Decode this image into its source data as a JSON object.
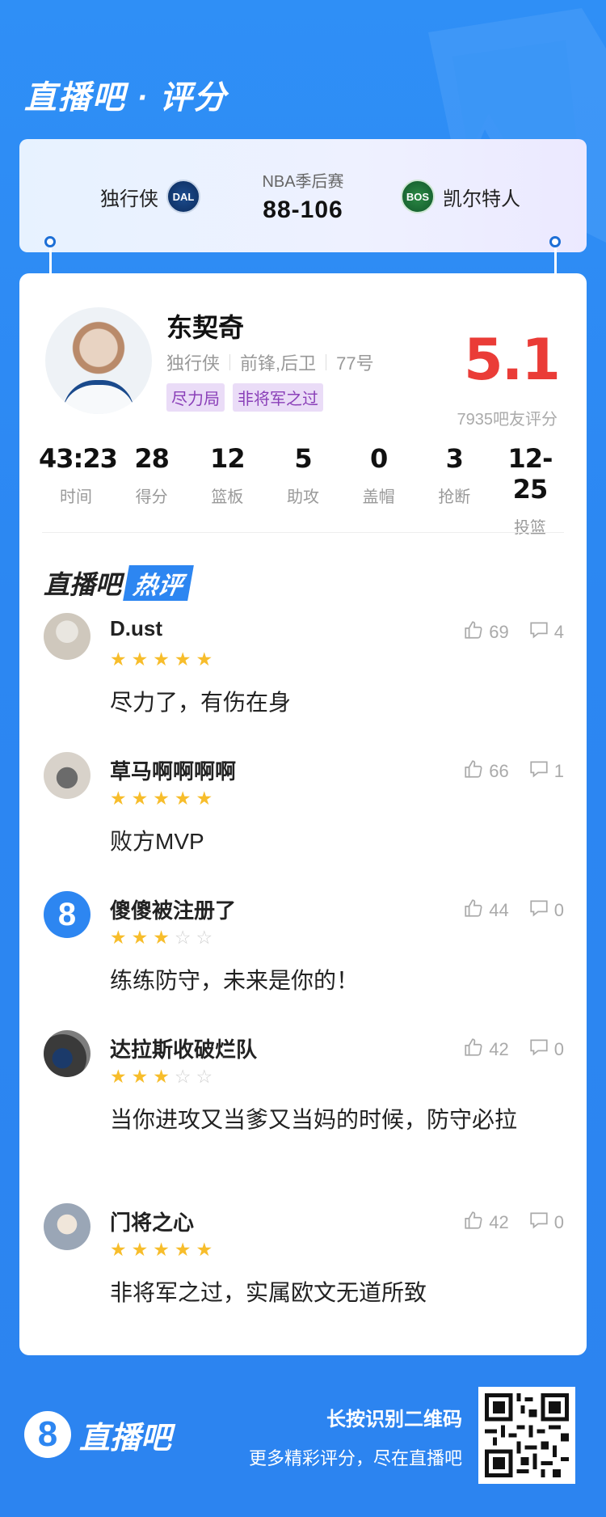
{
  "header": {
    "title": "直播吧 · 评分"
  },
  "match": {
    "home_team": "独行侠",
    "home_logo_text": "DAL",
    "away_team": "凯尔特人",
    "away_logo_text": "BOS",
    "competition": "NBA季后赛",
    "score": "88-106"
  },
  "player": {
    "name": "东契奇",
    "team": "独行侠",
    "position": "前锋,后卫",
    "number": "77号",
    "tags": [
      "尽力局",
      "非将军之过"
    ],
    "rating": "5.1",
    "rating_count": "7935吧友评分",
    "stats": [
      {
        "value": "43:23",
        "label": "时间"
      },
      {
        "value": "28",
        "label": "得分"
      },
      {
        "value": "12",
        "label": "篮板"
      },
      {
        "value": "5",
        "label": "助攻"
      },
      {
        "value": "0",
        "label": "盖帽"
      },
      {
        "value": "3",
        "label": "抢断"
      },
      {
        "value": "12-25",
        "label": "投篮"
      }
    ]
  },
  "hot_comments": {
    "title_left": "直播吧",
    "title_right": "热评",
    "items": [
      {
        "user": "D.ust",
        "stars": 5,
        "likes": "69",
        "replies": "4",
        "text": "尽力了，有伤在身",
        "avatar_icon": "user-photo-avatar"
      },
      {
        "user": "草马啊啊啊啊",
        "stars": 5,
        "likes": "66",
        "replies": "1",
        "text": "败方MVP",
        "avatar_icon": "cat-photo-avatar"
      },
      {
        "user": "傻傻被注册了",
        "stars": 3,
        "likes": "44",
        "replies": "0",
        "text": "练练防守，未来是你的！",
        "avatar_icon": "zhibo8-logo-avatar"
      },
      {
        "user": "达拉斯收破烂队",
        "stars": 3,
        "likes": "42",
        "replies": "0",
        "text": "当你进攻又当爹又当妈的时候，防守必拉",
        "avatar_icon": "team-photo-avatar"
      },
      {
        "user": "门将之心",
        "stars": 5,
        "likes": "42",
        "replies": "0",
        "text": "非将军之过，实属欧文无道所致",
        "avatar_icon": "player-photo-avatar"
      }
    ]
  },
  "footer": {
    "brand_badge": "8",
    "brand_name": "直播吧",
    "line1": "长按识别二维码",
    "line2": "更多精彩评分，尽在直播吧"
  },
  "colors": {
    "background": "#2d86f1",
    "rating": "#ea3c37",
    "star_on": "#f7bd2b",
    "tag_bg": "#eadcf7",
    "tag_text": "#8a3fb8"
  }
}
